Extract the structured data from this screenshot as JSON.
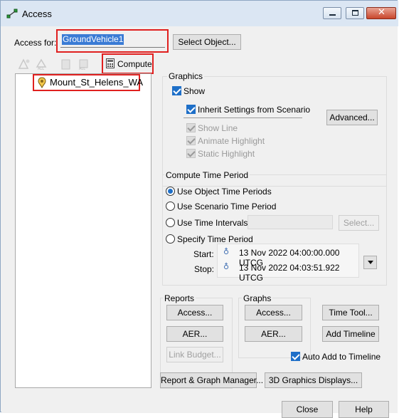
{
  "window": {
    "title": "Access"
  },
  "access_for": {
    "label": "Access for:",
    "value": "GroundVehicle1",
    "select_button": "Select Object..."
  },
  "toolbar": {
    "compute_label": "Compute"
  },
  "object_list": {
    "items": [
      {
        "label": "Mount_St_Helens_WA"
      }
    ]
  },
  "graphics": {
    "title": "Graphics",
    "show": "Show",
    "inherit": "Inherit Settings from Scenario",
    "show_line": "Show Line",
    "animate_highlight": "Animate Highlight",
    "static_highlight": "Static Highlight",
    "advanced_button": "Advanced..."
  },
  "compute_time": {
    "title": "Compute Time Period",
    "use_object": "Use Object Time Periods",
    "use_scenario": "Use Scenario Time Period",
    "use_intervals": "Use Time Intervals",
    "select_button": "Select...",
    "specify": "Specify Time Period",
    "start_label": "Start:",
    "stop_label": "Stop:",
    "start_value": "13 Nov 2022 04:00:00.000 UTCG",
    "stop_value": "13 Nov 2022 04:03:51.922 UTCG"
  },
  "reports": {
    "title": "Reports",
    "access": "Access...",
    "aer": "AER...",
    "link_budget": "Link Budget..."
  },
  "graphs": {
    "title": "Graphs",
    "access": "Access...",
    "aer": "AER..."
  },
  "side": {
    "time_tool": "Time Tool...",
    "add_timeline": "Add Timeline",
    "auto_add": "Auto Add to Timeline"
  },
  "bottom": {
    "manager": "Report & Graph Manager...",
    "displays": "3D Graphics Displays...",
    "close": "Close",
    "help": "Help"
  }
}
